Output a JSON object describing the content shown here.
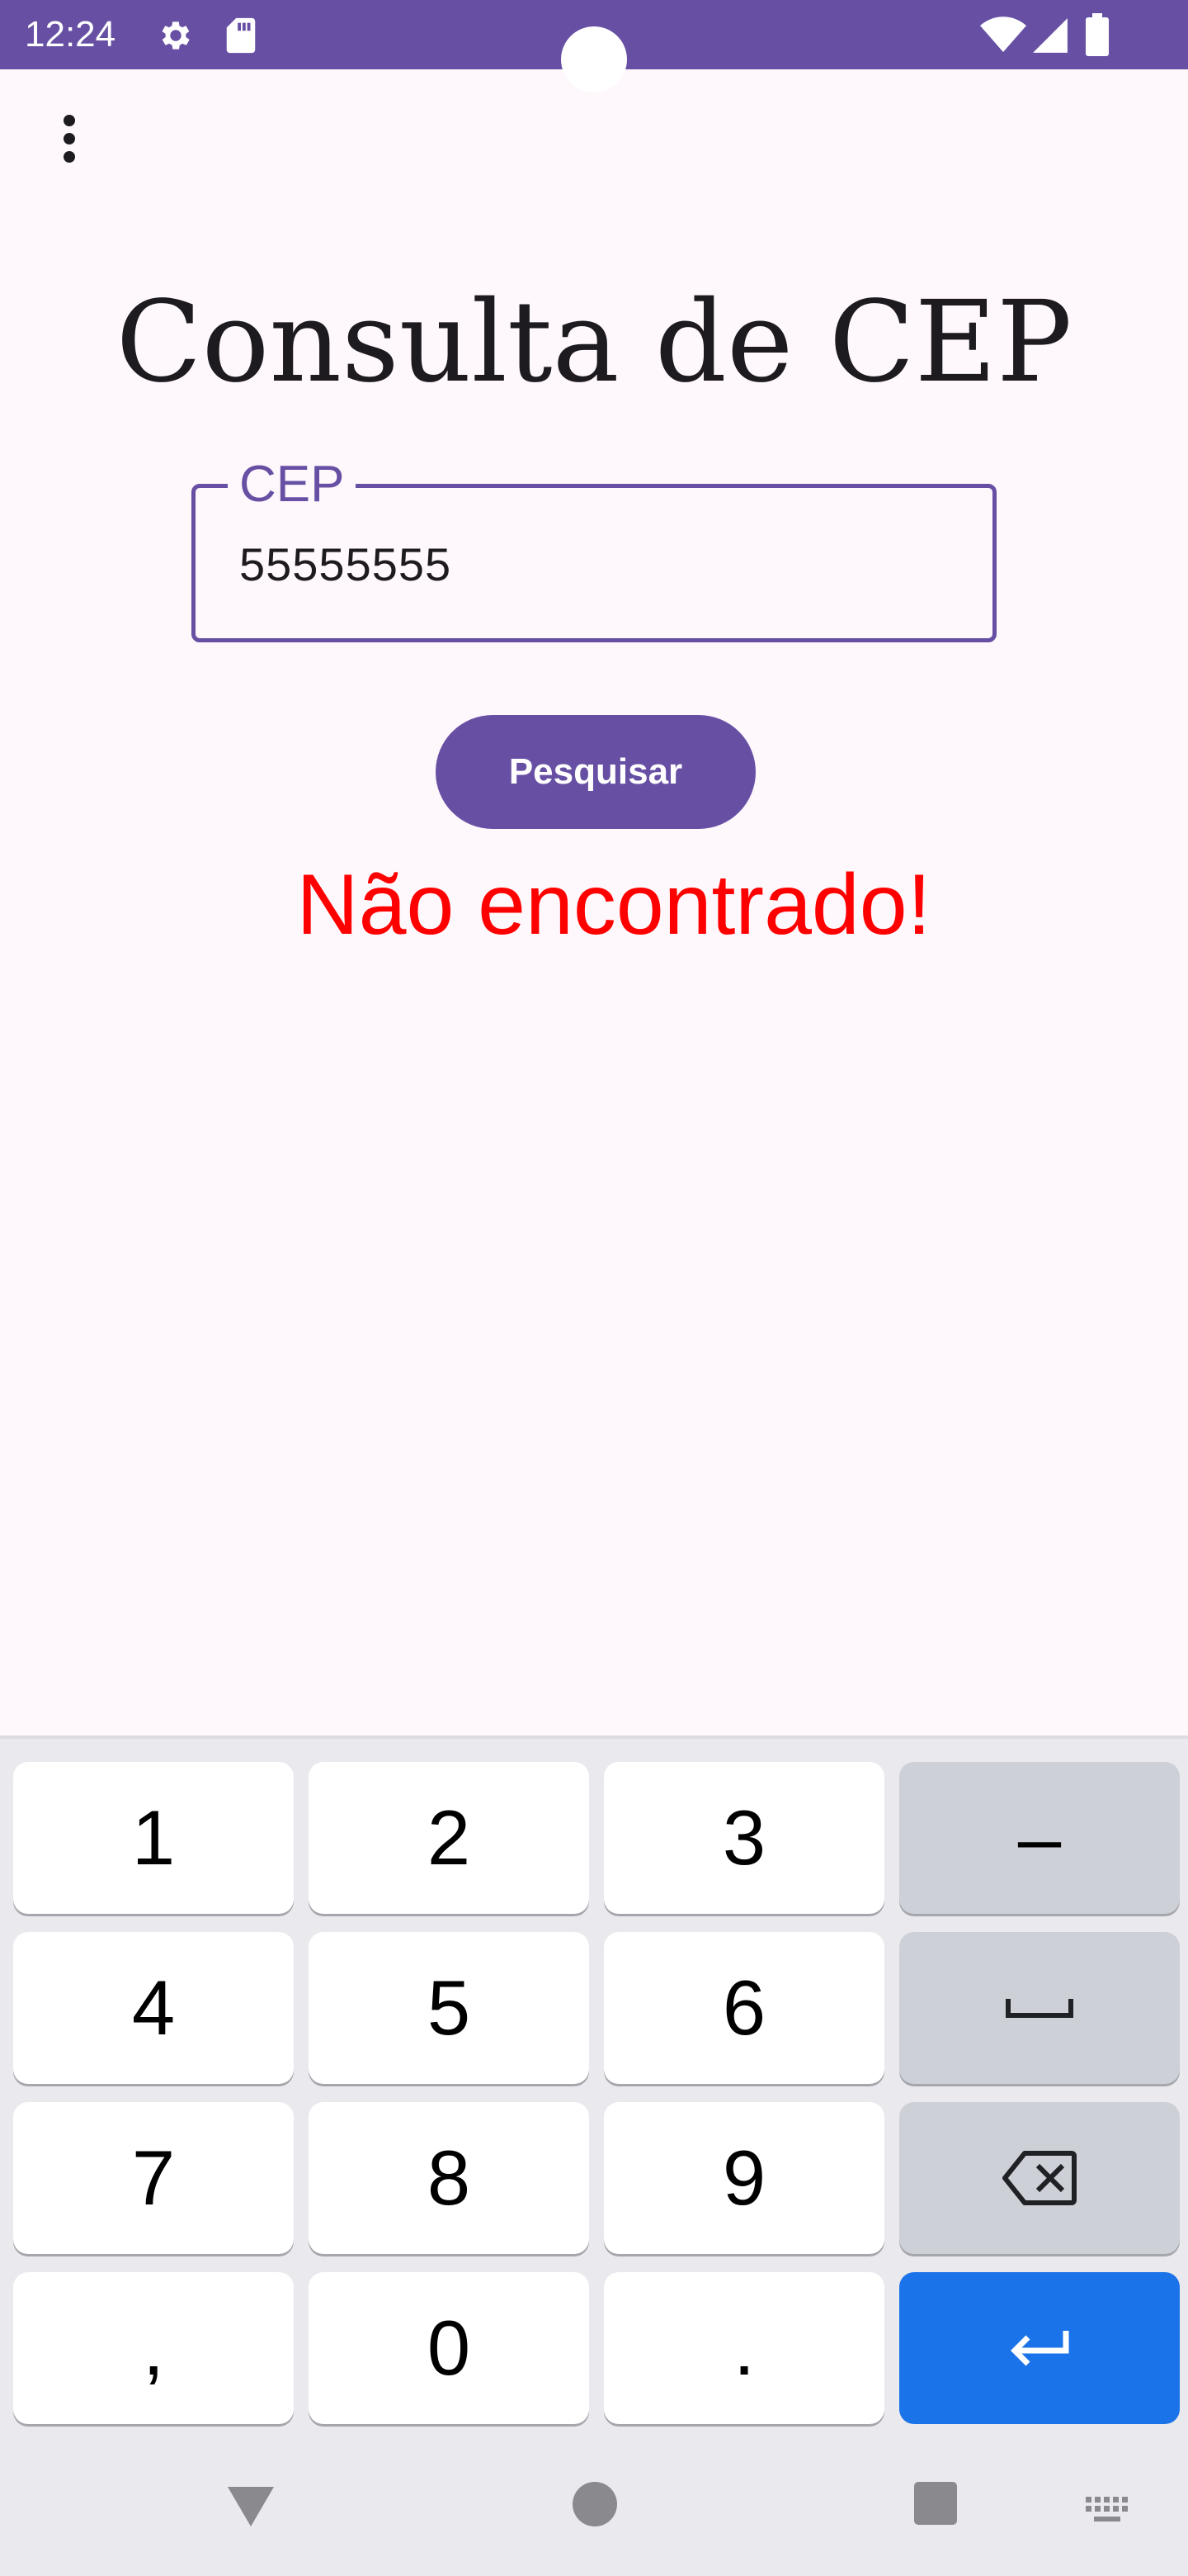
{
  "status_bar": {
    "time": "12:24",
    "background": "#6750a4",
    "icons": [
      "gear-icon",
      "sd-card-icon",
      "wifi-icon",
      "signal-icon",
      "battery-icon"
    ]
  },
  "app": {
    "menu_icon": "overflow-menu-icon",
    "title": "Consulta de CEP",
    "cep_field": {
      "label": "CEP",
      "value": "55555555"
    },
    "search_button": "Pesquisar",
    "result_message": "Não encontrado!",
    "accent_color": "#6750a4",
    "error_color": "#ff0000"
  },
  "keyboard": {
    "rows": [
      [
        "1",
        "2",
        "3",
        "–"
      ],
      [
        "4",
        "5",
        "6",
        "space"
      ],
      [
        "7",
        "8",
        "9",
        "backspace"
      ],
      [
        ",",
        "0",
        ".",
        "enter"
      ]
    ],
    "enter_color": "#1a73e8"
  },
  "nav_bar": {
    "icons": [
      "back-icon",
      "home-icon",
      "recents-icon",
      "keyboard-switch-icon"
    ]
  }
}
